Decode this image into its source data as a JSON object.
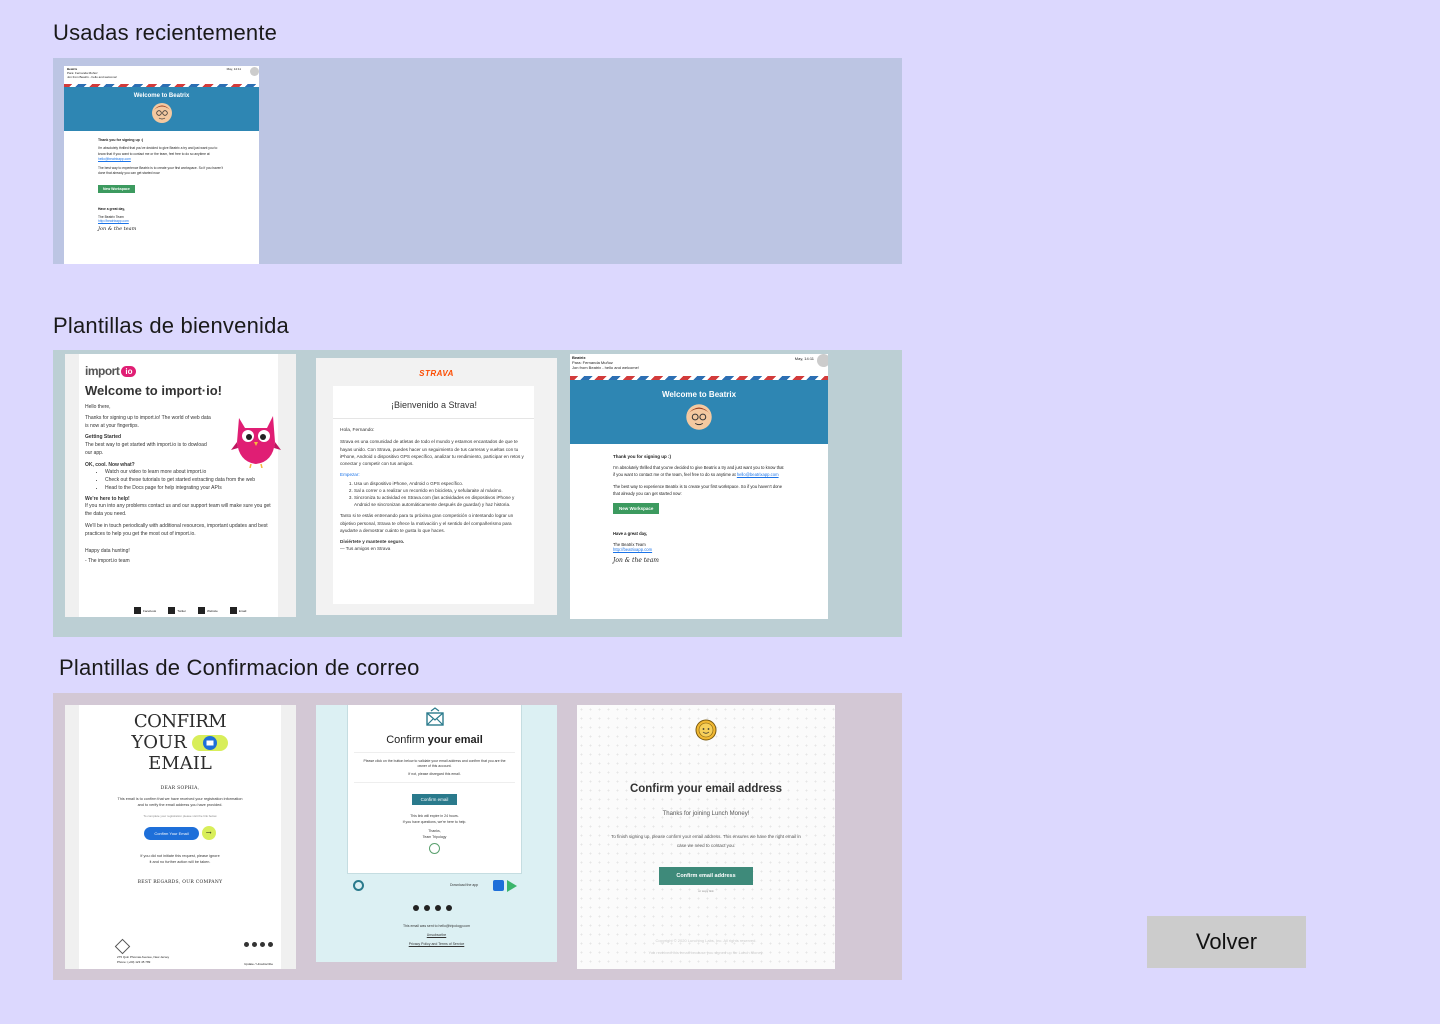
{
  "sections": {
    "recent": {
      "title": "Usadas recientemente"
    },
    "welcome": {
      "title": "Plantillas de bienvenida"
    },
    "confirm": {
      "title": "Plantillas de Confirmacion de correo"
    }
  },
  "beatrix": {
    "sender": "Beatrix",
    "para": "Para:  Fernanda Muñoz",
    "subject": "Jon from Beatrix - hello and welcome!",
    "date": "May, 14:11",
    "header": "Welcome to Beatrix",
    "thanks": "Thank you for signing up :)",
    "p1": "I'm absolutely thrilled that you've decided to give Beatrix a try and just want you to know that if you want to contact me or the team, feel free to do so anytime at",
    "email": "hello@beatrixapp.com",
    "p2": "The best way to experience Beatrix is to create your first workspace. So if you haven't done that already you can get started now:",
    "button": "New Workspace",
    "greet": "Have a great day,",
    "team": "The Beatrix Team",
    "url": "http://beatrixapp.com",
    "sign": "Jon & the team"
  },
  "importio": {
    "logo": "import",
    "logo_badge": "io",
    "title": "Welcome to import·io!",
    "hello": "Hello there,",
    "p1": "Thanks for signing up to import.io! The world of web data is now at your fingertips.",
    "h1": "Getting Started",
    "p2": "The best way to get started with import.io is to dowload our app.",
    "h2": "OK, cool. Now what?",
    "li1": "Watch our video to learn more about import.io",
    "li2": "Check out these tutorials to get started extracting data from the web",
    "li3": "Head to the Docs page for help integrating your APIs",
    "h3": "We're here to help!",
    "p3": "If you run into any problems contact us and our support team will make sure you get the data you need.",
    "p4": "We'll be in touch periodically with additional resources, important updates and best practices to help you get the most out of import.io.",
    "p5": "Happy data hunting!",
    "p6": "- The import.io team",
    "social": [
      "Facebook",
      "Twitter",
      "Website",
      "Email"
    ]
  },
  "strava": {
    "logo": "STRAVA",
    "title": "¡Bienvenido a Strava!",
    "greet": "Hola, Fernando:",
    "p1": "Strava es una comunidad de atletas de todo el mundo y estamos encantados de que te hayas unido. Con Strava, puedes hacer un seguimiento de tus carreras y vueltas con tu iPhone, Android o dispositivo GPS específico, analizar tu rendimiento, participar en retos y conectar y competir con tus amigos.",
    "start": "Empezar:",
    "li1": "Usa un dispositivo iPhone, Android o GPS específico.",
    "li2": "Sal a correr o a realizar un recorrido en bicicleta, y sefularaite al máximo.",
    "li3": "Sincroniza tu actividad en Strava.com (las actividades en dispositivos iPhone y Android se sincronizan automáticamente después de guardar) y haz historia.",
    "p2": "Tanto si te estás entrenando para tu próxima gran competición o intentando lograr un objetivo personal, Strava te ofrece la motivación y el sentido del compañerismo para ayudarte a demostrar cuánto te gusta lo que haces.",
    "p3": "Diviértete y mantente seguro.",
    "p4": "— Tus amigos en Strava"
  },
  "confirm1": {
    "line1": "CONFIRM",
    "line2": "YOUR",
    "line3": "EMAIL",
    "dear": "DEAR SOPHIA,",
    "p1": "This email is to confirm that we have received your registration information and to verify the email address you have provided.",
    "p2": "To complete your registration please visit the link below",
    "button": "Confirm Your Email",
    "p3": "If you did not initiate this request, please ignore it and no further action will be taken.",
    "regards": "BEST REGARDS, OUR COMPANY",
    "footer1": "275 Quin Phomas Avenue, New Jersey",
    "footer2": "Phone: (+00) 123 45 789",
    "unsub": "Update / Unsubscribe"
  },
  "confirm2": {
    "title_a": "Confirm",
    "title_b": "your email",
    "p1": "Please click on the button below to validate your email address and confirm that you are the owner of this account.",
    "p2": "If not, please disregard this email.",
    "button": "Confirm email",
    "p3": "This link will expire in 24 hours.",
    "p4": "If you have questions, we're here to help.",
    "thanks": "Thanks,",
    "team": "Team Tripology",
    "download": "Download the app",
    "sent": "This email was sent to hello@tripology.com",
    "unsub": "Unsubscribe",
    "policy": "Privacy Policy and Terms of Service"
  },
  "confirm3": {
    "title": "Confirm your email address",
    "sub": "Thanks for joining Lunch Money!",
    "p1": "To finish signing up, please confirm your email address. This ensures we have the right email in case we need to contact you.",
    "button": "Confirm email address",
    "small": "or copy link",
    "footer1": "Copyright © 2020 Lunching Labs, Inc. All rights reserved.",
    "footer2": "You received this email because you signed up for Lunch Money."
  },
  "volver": "Volver",
  "colors": {
    "background": "#dcd8fe",
    "recent_strip": "#bcc5e3",
    "welcome_strip": "#bccfd4",
    "confirm_strip": "#d3c8d5",
    "beatrix_blue": "#2e86b3",
    "import_pink": "#e01e74",
    "strava_orange": "#fc4c02",
    "button_gray": "#cccccc"
  }
}
